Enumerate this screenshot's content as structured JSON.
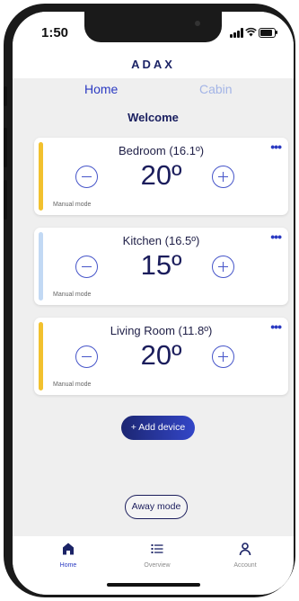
{
  "status_bar": {
    "time": "1:50"
  },
  "brand": {
    "logo_text": "ADAX"
  },
  "tabs": [
    {
      "label": "Home",
      "active": true
    },
    {
      "label": "Cabin",
      "active": false
    }
  ],
  "welcome": "Welcome",
  "devices": [
    {
      "title": "Bedroom (16.1º)",
      "temperature": "20º",
      "mode": "Manual mode",
      "accent": "#f2c12e"
    },
    {
      "title": "Kitchen (16.5º)",
      "temperature": "15º",
      "mode": "Manual mode",
      "accent": "#c2d9f4"
    },
    {
      "title": "Living Room (11.8º)",
      "temperature": "20º",
      "mode": "Manual mode",
      "accent": "#f2c12e"
    }
  ],
  "add_device_label": "+ Add device",
  "away_mode_label": "Away mode",
  "bottom_nav": [
    {
      "label": "Home",
      "icon": "home-icon",
      "active": true
    },
    {
      "label": "Overview",
      "icon": "list-icon",
      "active": false
    },
    {
      "label": "Account",
      "icon": "account-icon",
      "active": false
    }
  ],
  "colors": {
    "primary": "#2b3ac2",
    "dark_navy": "#1b1d5c",
    "inactive_tab": "#a3b4e6",
    "heating_accent": "#f2c12e",
    "cool_accent": "#c2d9f4"
  }
}
